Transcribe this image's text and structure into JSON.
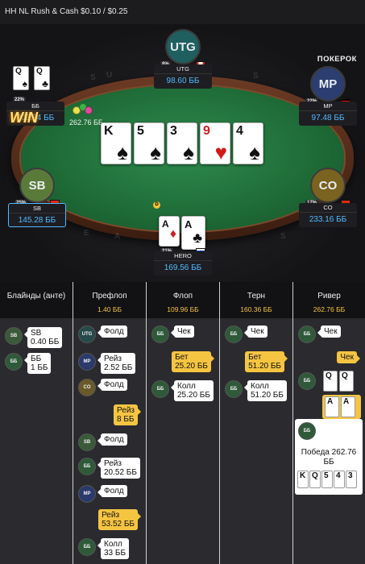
{
  "header": {
    "game_title": "HH NL Rush & Cash $0.10 / $0.25",
    "brand": "ПОКЕРОК"
  },
  "table": {
    "rail_letters": [
      "S",
      "U",
      "S",
      "E",
      "A",
      "S"
    ],
    "pot_display": "262.76 ББ",
    "dealer_icon": "dealer-button",
    "win_badge": "WIN",
    "seats": {
      "utg": {
        "avatar": "UTG",
        "name": "UTG",
        "stack": "98.60 ББ",
        "pct": "8%",
        "flag": "canada-flag"
      },
      "bb": {
        "name": "ББ",
        "stack": "203.84 ББ",
        "pct": "22%",
        "cards": [
          "Q",
          "Q"
        ]
      },
      "mp": {
        "avatar": "MP",
        "name": "MP",
        "stack": "97.48 ББ",
        "pct": "22%",
        "flag": "germany-flag"
      },
      "sb": {
        "avatar": "SB",
        "name": "SB",
        "stack": "145.28 ББ",
        "pct": "25%",
        "flag": "china-flag"
      },
      "co": {
        "avatar": "CO",
        "name": "CO",
        "stack": "233.16 ББ",
        "pct": "17%",
        "flag": "china-flag"
      },
      "hero": {
        "name": "HERO",
        "stack": "169.56 ББ",
        "pct": "21%",
        "flag": "russia-flag",
        "cards": [
          "A",
          "A"
        ]
      }
    },
    "board": [
      {
        "rank": "K",
        "suit": "♠",
        "color": "#111111"
      },
      {
        "rank": "5",
        "suit": "♠",
        "color": "#111111"
      },
      {
        "rank": "3",
        "suit": "♠",
        "color": "#111111"
      },
      {
        "rank": "9",
        "suit": "♥",
        "color": "#d11b1b"
      },
      {
        "rank": "4",
        "suit": "♠",
        "color": "#111111"
      }
    ]
  },
  "history": {
    "columns": [
      {
        "title": "Блайнды (анте)",
        "pot": ""
      },
      {
        "title": "Префлоп",
        "pot": "1.40 ББ"
      },
      {
        "title": "Флоп",
        "pot": "109.96 ББ"
      },
      {
        "title": "Терн",
        "pot": "160.36 ББ"
      },
      {
        "title": "Ривер",
        "pot": "262.76 ББ"
      }
    ],
    "blinds": [
      {
        "pos": "SB",
        "text": "SB\n0.40 ББ"
      },
      {
        "pos": "ББ",
        "text": "ББ\n1 ББ"
      }
    ],
    "preflop": [
      {
        "pos": "UTG",
        "text": "Фолд"
      },
      {
        "pos": "MP",
        "text": "Рейз\n2.52 ББ"
      },
      {
        "pos": "CO",
        "text": "Фолд"
      },
      {
        "pos": "hero",
        "text": "Рейз\n8 ББ"
      },
      {
        "pos": "SB",
        "text": "Фолд"
      },
      {
        "pos": "ББ",
        "text": "Рейз\n20.52 ББ"
      },
      {
        "pos": "MP",
        "text": "Фолд"
      },
      {
        "pos": "hero",
        "text": "Рейз\n53.52 ББ"
      },
      {
        "pos": "ББ",
        "text": "Колл\n33 ББ"
      }
    ],
    "flop": [
      {
        "pos": "ББ",
        "text": "Чек"
      },
      {
        "pos": "hero",
        "text": "Бет\n25.20 ББ"
      },
      {
        "pos": "ББ",
        "text": "Колл\n25.20 ББ"
      }
    ],
    "turn": [
      {
        "pos": "ББ",
        "text": "Чек"
      },
      {
        "pos": "hero",
        "text": "Бет\n51.20 ББ"
      },
      {
        "pos": "ББ",
        "text": "Колл\n51.20 ББ"
      }
    ],
    "river": [
      {
        "pos": "ББ",
        "text": "Чек"
      },
      {
        "pos": "hero",
        "text": "Чек"
      },
      {
        "pos": "ББ",
        "text": ""
      },
      {
        "pos": "hero",
        "text": ""
      }
    ],
    "river_show_bb": [
      "Q",
      "Q"
    ],
    "river_show_hero": [
      "A",
      "A"
    ],
    "result": {
      "pos": "ББ",
      "text": "Победа 262.76 ББ",
      "hand": [
        "K",
        "Q",
        "5",
        "4",
        "3"
      ]
    }
  }
}
